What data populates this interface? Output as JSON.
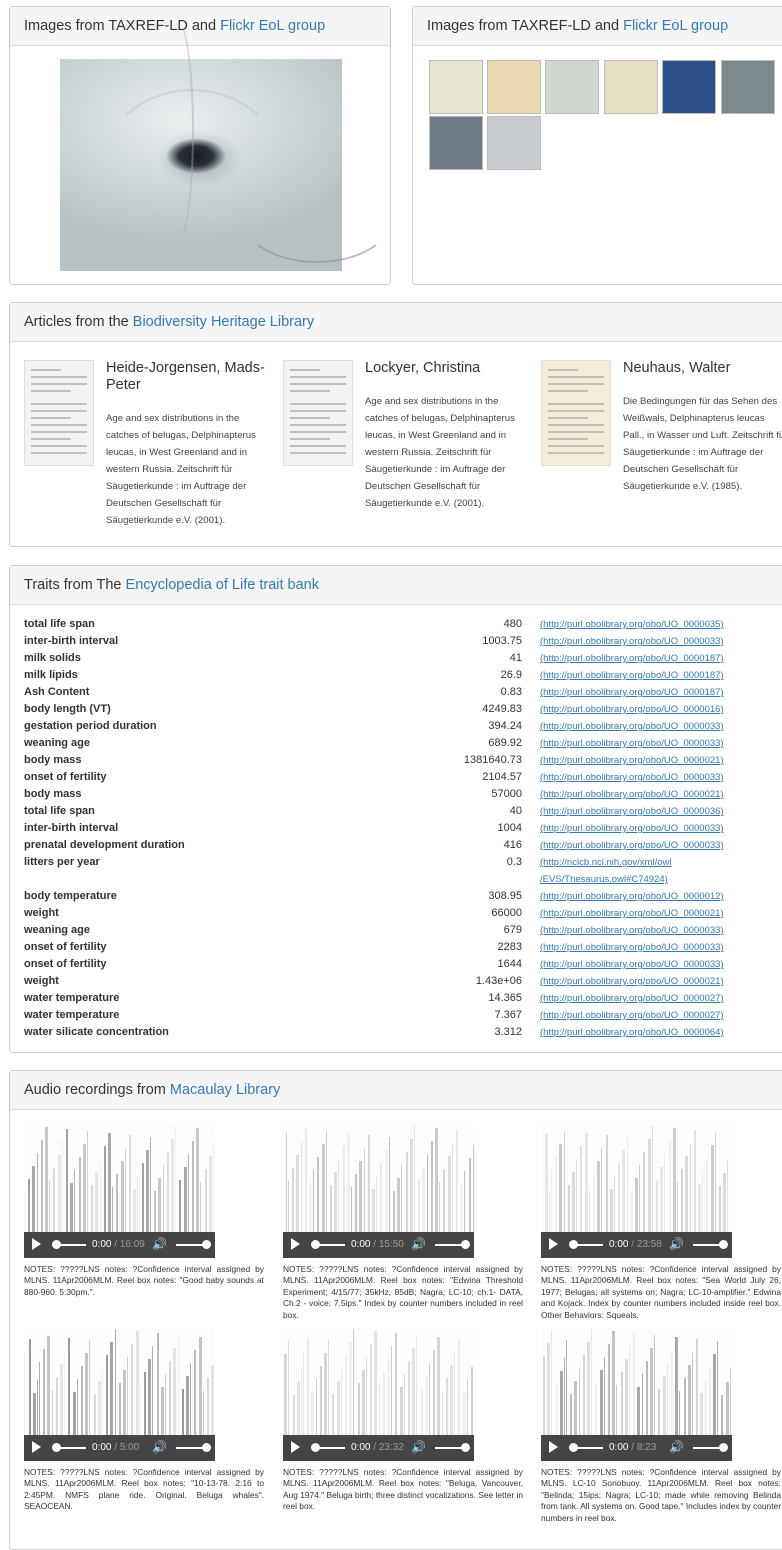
{
  "images_panel_left": {
    "heading_prefix": "Images from TAXREF-LD and ",
    "heading_link": "Flickr EoL group",
    "prev": "‹",
    "next": "›"
  },
  "images_panel_right": {
    "heading_prefix": "Images from TAXREF-LD and ",
    "heading_link": "Flickr EoL group",
    "thumb_colors": [
      "#e8e4d4",
      "#ead9b0",
      "#cfd7cf",
      "#e6dfc5",
      "#2c4f8a",
      "#7c8a8e",
      "#6e7b86",
      "#c8ced0"
    ]
  },
  "articles": {
    "heading_prefix": "Articles from the ",
    "heading_link": "Biodiversity Heritage Library",
    "items": [
      {
        "author": "Heide-Jorgensen, Mads-Peter",
        "desc": "Age and sex distributions in the catches of belugas, Delphinapterus leucas, in West Greenland and in western Russia. Zeitschrift für Säugetierkunde : im Auftrage der Deutschen Gesellschaft für Säugetierkunde e.V. (2001)."
      },
      {
        "author": "Lockyer, Christina",
        "desc": "Age and sex distributions in the catches of belugas, Delphinapterus leucas, in West Greenland and in western Russia. Zeitschrift für Säugetierkunde : im Auftrage der Deutschen Gesellschaft für Säugetierkunde e.V. (2001)."
      },
      {
        "author": "Neuhaus, Walter",
        "desc": "Die Bedingungen für das Sehen des Weißwals, Delphinapterus leucas Pall., in Wasser und Luft. Zeitschrift für Säugetierkunde : im Auftrage der Deutschen Gesellschaft für Säugetierkunde e.V. (1985)."
      }
    ]
  },
  "traits": {
    "heading_prefix": "Traits from The ",
    "heading_link": "Encyclopedia of Life trait bank",
    "rows": [
      {
        "name": "total life span",
        "value": "480",
        "unit": "(http://purl.obolibrary.org/obo/UO_0000035)"
      },
      {
        "name": "inter-birth interval",
        "value": "1003.75",
        "unit": "(http://purl.obolibrary.org/obo/UO_0000033)"
      },
      {
        "name": "milk solids",
        "value": "41",
        "unit": "(http://purl.obolibrary.org/obo/UO_0000187)"
      },
      {
        "name": "milk lipids",
        "value": "26.9",
        "unit": "(http://purl.obolibrary.org/obo/UO_0000187)"
      },
      {
        "name": "Ash Content",
        "value": "0.83",
        "unit": "(http://purl.obolibrary.org/obo/UO_0000187)"
      },
      {
        "name": "body length (VT)",
        "value": "4249.83",
        "unit": "(http://purl.obolibrary.org/obo/UO_0000016)"
      },
      {
        "name": "gestation period duration",
        "value": "394.24",
        "unit": "(http://purl.obolibrary.org/obo/UO_0000033)"
      },
      {
        "name": "weaning age",
        "value": "689.92",
        "unit": "(http://purl.obolibrary.org/obo/UO_0000033)"
      },
      {
        "name": "body mass",
        "value": "1381640.73",
        "unit": "(http://purl.obolibrary.org/obo/UO_0000021)"
      },
      {
        "name": "onset of fertility",
        "value": "2104.57",
        "unit": "(http://purl.obolibrary.org/obo/UO_0000033)"
      },
      {
        "name": "body mass",
        "value": "57000",
        "unit": "(http://purl.obolibrary.org/obo/UO_0000021)"
      },
      {
        "name": "total life span",
        "value": "40",
        "unit": "(http://purl.obolibrary.org/obo/UO_0000036)"
      },
      {
        "name": "inter-birth interval",
        "value": "1004",
        "unit": "(http://purl.obolibrary.org/obo/UO_0000033)"
      },
      {
        "name": "prenatal development duration",
        "value": "416",
        "unit": "(http://purl.obolibrary.org/obo/UO_0000033)"
      },
      {
        "name": "litters per year",
        "value": "0.3",
        "unit": "(http://ncicb.nci.nih.gov/xml/owl",
        "unit2": "/EVS/Thesaurus.owl#C74924)"
      },
      {
        "name": "body temperature",
        "value": "308.95",
        "unit": "(http://purl.obolibrary.org/obo/UO_0000012)"
      },
      {
        "name": "weight",
        "value": "66000",
        "unit": "(http://purl.obolibrary.org/obo/UO_0000021)"
      },
      {
        "name": "weaning age",
        "value": "679",
        "unit": "(http://purl.obolibrary.org/obo/UO_0000033)"
      },
      {
        "name": "onset of fertility",
        "value": "2283",
        "unit": "(http://purl.obolibrary.org/obo/UO_0000033)"
      },
      {
        "name": "onset of fertility",
        "value": "1644",
        "unit": "(http://purl.obolibrary.org/obo/UO_0000033)"
      },
      {
        "name": "weight",
        "value": "1.43e+06",
        "unit": "(http://purl.obolibrary.org/obo/UO_0000021)"
      },
      {
        "name": "water temperature",
        "value": "14.365",
        "unit": "(http://purl.obolibrary.org/obo/UO_0000027)"
      },
      {
        "name": "water temperature",
        "value": "7.367",
        "unit": "(http://purl.obolibrary.org/obo/UO_0000027)"
      },
      {
        "name": "water silicate concentration",
        "value": "3.312",
        "unit": "(http://purl.obolibrary.org/obo/UO_0000064)"
      }
    ]
  },
  "audio": {
    "heading_prefix": "Audio recordings from ",
    "heading_link": "Macaulay Library",
    "items": [
      {
        "current": "0:00",
        "duration": "16:09",
        "notes": "NOTES: ?????LNS notes: ?Confidence interval assigned by MLNS. 11Apr2006MLM. Reel box notes: \"Good baby sounds at 880-960. 5:30pm.\"."
      },
      {
        "current": "0:00",
        "duration": "15:50",
        "notes": "NOTES: ?????LNS notes: ?Confidence interval assigned by MLNS. 11Apr2006MLM. Reel box notes: \"Edwina Threshold Experiment; 4/15/77; 35kHz, 85dB; Nagra; LC-10; ch.1- DATA, Ch.2 - voice; 7.5ips.\" Index by counter numbers included in reel box."
      },
      {
        "current": "0:00",
        "duration": "23:58",
        "notes": "NOTES: ?????LNS notes: ?Confidence interval assigned by MLNS. 11Apr2006MLM. Reel box notes: \"Sea World July 26, 1977; Belugas; all systems on; Nagra; LC-10-amplifier.\" Edwina and Kojack. Index by counter numbers included inside reel box. Other Behaviors: Squeals."
      },
      {
        "current": "0:00",
        "duration": "5:00",
        "notes": "NOTES: ?????LNS notes: ?Confidence interval assigned by MLNS. 11Apr2006MLM. Reel box notes: \"10-13-78. 2:16 to 2:45PM. NMFS plane ride. Original. Beluga whales\". SEAOCEAN."
      },
      {
        "current": "0:00",
        "duration": "23:32",
        "notes": "NOTES: ?????LNS notes: ?Confidence interval assigned by MLNS. 11Apr2006MLM. Reel box notes: \"Beluga, Vancouver, Aug 1974.\" Beluga birth; three distinct vocalizations. See letter in reel box."
      },
      {
        "current": "0:00",
        "duration": "8:23",
        "notes": "NOTES: ?????LNS notes: ?Confidence interval assigned by MLNS. LC-10 Sonobuoy. 11Apr2006MLM. Reel box notes: \"Belinda; 15ips; Nagra; LC-10; made while removing Belinda from tank. All systems on. Good tape.\" Includes index by counter numbers in reel box."
      }
    ],
    "sep": " / ",
    "volume_icon": "🔊"
  }
}
